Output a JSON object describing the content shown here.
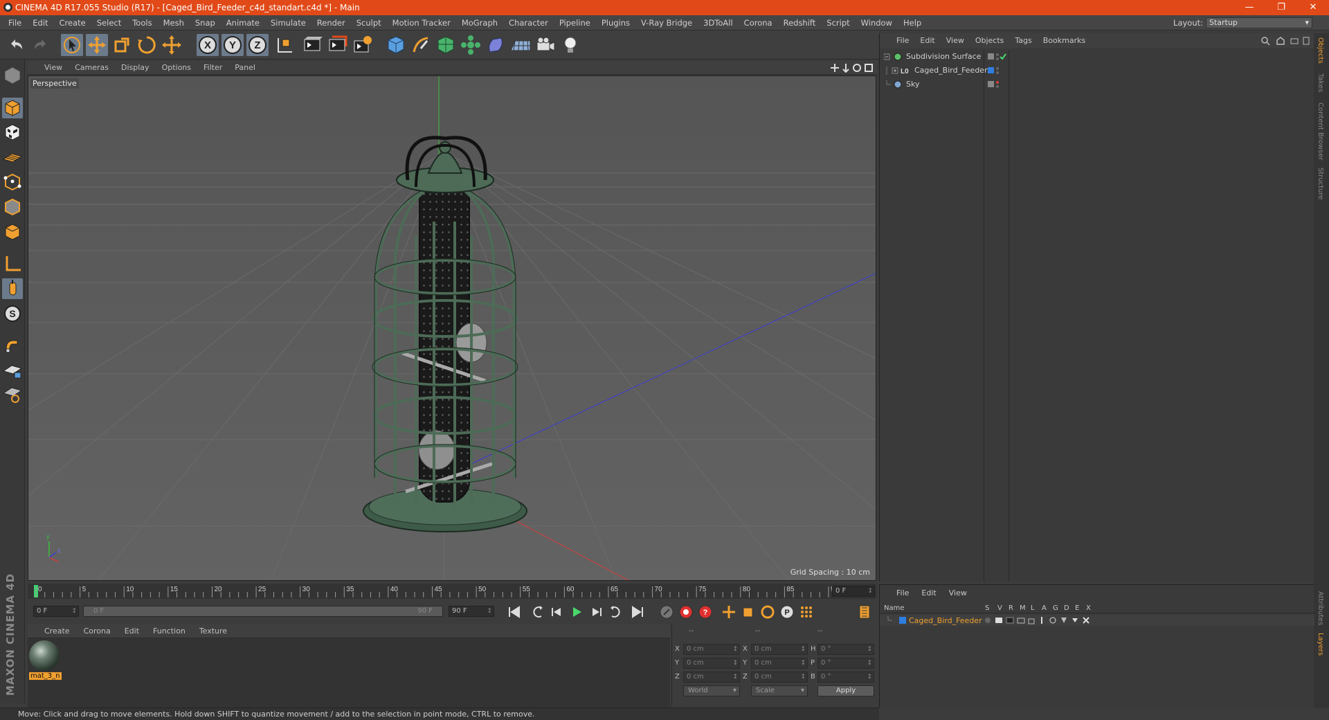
{
  "window": {
    "title": "CINEMA 4D R17.055 Studio (R17) - [Caged_Bird_Feeder_c4d_standart.c4d *] - Main",
    "minimize": "—",
    "restore": "❐",
    "close": "✕"
  },
  "menu": {
    "items": [
      "File",
      "Edit",
      "Create",
      "Select",
      "Tools",
      "Mesh",
      "Snap",
      "Animate",
      "Simulate",
      "Render",
      "Sculpt",
      "Motion Tracker",
      "MoGraph",
      "Character",
      "Pipeline",
      "Plugins",
      "V-Ray Bridge",
      "3DToAll",
      "Corona",
      "Redshift",
      "Script",
      "Window",
      "Help"
    ],
    "layout_label": "Layout:",
    "layout_value": "Startup"
  },
  "toolbar": {
    "icons": [
      "undo-icon",
      "redo-icon",
      "live-select-icon",
      "move-icon",
      "scale-icon",
      "rotate-icon",
      "recent-tool-icon",
      "x-axis-icon",
      "y-axis-icon",
      "z-axis-icon",
      "coordinate-system-icon",
      "render-view-icon",
      "render-picture-viewer-icon",
      "edit-render-settings-icon",
      "cube-icon",
      "pen-icon",
      "subdivision-icon",
      "array-icon",
      "deformer-icon",
      "floor-icon",
      "camera-icon",
      "light-icon"
    ],
    "axis_labels": {
      "x": "X",
      "y": "Y",
      "z": "Z"
    }
  },
  "left_palette": {
    "icons": [
      "make-editable-icon",
      "model-mode-icon",
      "texture-mode-icon",
      "workplane-icon",
      "points-mode-icon",
      "edges-mode-icon",
      "polygons-mode-icon",
      "axis-mode-icon",
      "tweak-mode-icon",
      "solo-mode-icon",
      "snap-icon",
      "workplane-lock-icon",
      "locked-workplane-icon"
    ],
    "solo_letter": "S",
    "brand": "MAXON CINEMA 4D"
  },
  "viewport": {
    "menus": [
      "View",
      "Cameras",
      "Display",
      "Options",
      "Filter",
      "Panel"
    ],
    "label": "Perspective",
    "grid_spacing": "Grid Spacing : 10 cm",
    "axis_y": "y",
    "axis_z": "z"
  },
  "timeline": {
    "ticks": [
      "0",
      "5",
      "10",
      "15",
      "20",
      "25",
      "30",
      "35",
      "40",
      "45",
      "50",
      "55",
      "60",
      "65",
      "70",
      "75",
      "80",
      "85",
      "90"
    ],
    "current_frame": "0 F",
    "start_frame": "0 F",
    "range_start": "0 F",
    "range_end": "90 F",
    "end_frame": "90 F"
  },
  "material_manager": {
    "menus": [
      "Create",
      "Corona",
      "Edit",
      "Function",
      "Texture"
    ],
    "material_name": "mat_3_n"
  },
  "coordinates": {
    "headers": [
      "--",
      "--",
      "--"
    ],
    "rows": [
      {
        "label_a": "X",
        "pos": "0 cm",
        "label_b": "X",
        "size": "0 cm",
        "label_c": "H",
        "rot": "0 °"
      },
      {
        "label_a": "Y",
        "pos": "0 cm",
        "label_b": "Y",
        "size": "0 cm",
        "label_c": "P",
        "rot": "0 °"
      },
      {
        "label_a": "Z",
        "pos": "0 cm",
        "label_b": "Z",
        "size": "0 cm",
        "label_c": "B",
        "rot": "0 °"
      }
    ],
    "mode_world": "World",
    "mode_scale": "Scale",
    "apply": "Apply"
  },
  "status": {
    "text": "Move: Click and drag to move elements. Hold down SHIFT to quantize movement / add to the selection in point mode, CTRL to remove."
  },
  "object_manager": {
    "menus": [
      "File",
      "Edit",
      "View",
      "Objects",
      "Tags",
      "Bookmarks"
    ],
    "objects": [
      {
        "name": "Subdivision Surface",
        "color": "#5dbf6a"
      },
      {
        "name": "Caged_Bird_Feeder",
        "color": "#2f7fe0"
      },
      {
        "name": "Sky",
        "color": "#7fa7d0"
      }
    ]
  },
  "side_tabs": [
    "Objects",
    "Takes",
    "Content Browser",
    "Structure"
  ],
  "side_tabs_bottom": [
    "Attributes",
    "Layers"
  ],
  "layer_manager": {
    "menus": [
      "File",
      "Edit",
      "View"
    ],
    "columns": [
      "Name",
      "S",
      "V",
      "R",
      "M",
      "L",
      "A",
      "G",
      "D",
      "E",
      "X"
    ],
    "layer_name": "Caged_Bird_Feeder"
  },
  "colors": {
    "accent": "#e14a18",
    "selection": "#f0a030",
    "active_tool": "#6c7b8c",
    "cage": "#4d6b57"
  }
}
